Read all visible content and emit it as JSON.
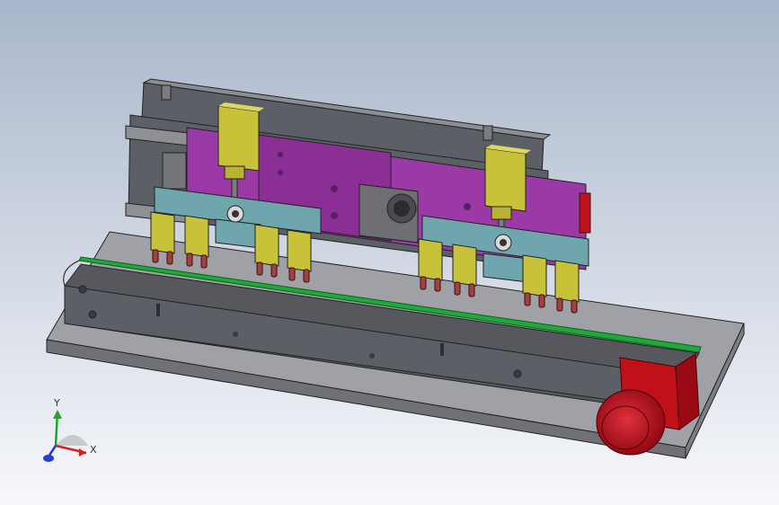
{
  "viewport": {
    "background_top": "#a9b6cb",
    "background_bottom": "#f7f8fb"
  },
  "model": {
    "frame_color": "#5d5f66",
    "plate_color": "#9fa1a6",
    "slide_plate_color": "#9b39a6",
    "gripper_bar_color": "#6fa6ad",
    "cylinder_color": "#c8c23a",
    "finger_tip_color": "#a3413f",
    "belt_color": "#1ea93a",
    "motor_color": "#c0101a"
  },
  "triad": {
    "x_label": "X",
    "y_label": "Y",
    "x_color": "#d42020",
    "y_color": "#22a52a",
    "z_color": "#1f3fd6"
  }
}
